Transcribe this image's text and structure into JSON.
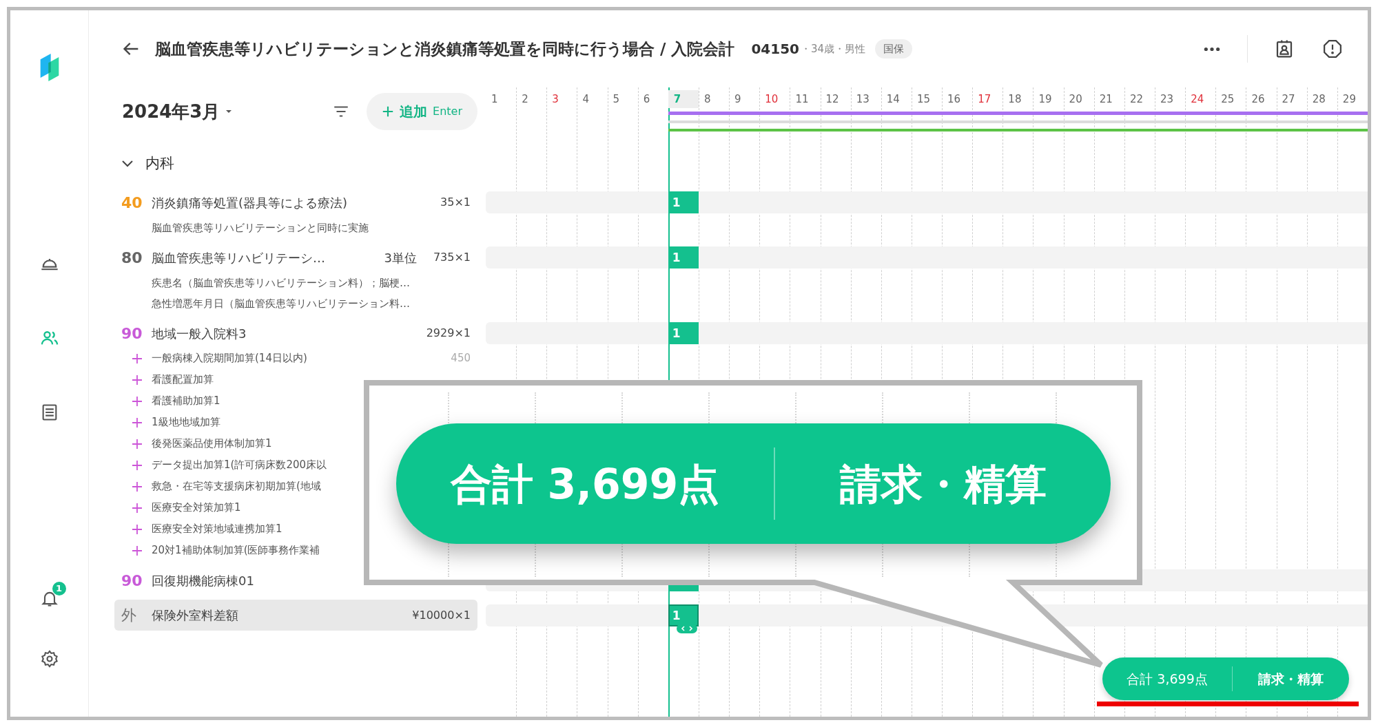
{
  "sidebar": {
    "items": [
      {
        "kind": "tray",
        "selected": false
      },
      {
        "kind": "people",
        "selected": true
      },
      {
        "kind": "list",
        "selected": false
      }
    ],
    "bottom_items": [
      {
        "kind": "bell",
        "badge": "1"
      },
      {
        "kind": "gear"
      }
    ]
  },
  "header": {
    "title": "脳血管疾患等リハビリテーションと消炎鎮痛等処置を同時に行う場合 / 入院会計",
    "patient_id": "04150",
    "details": "・34歳・男性",
    "insurance": "国保"
  },
  "toolbar": {
    "month": "2024年3月",
    "add_label": "追加",
    "add_shortcut": "Enter"
  },
  "calendar": {
    "days": [
      {
        "label": "1",
        "holiday": false,
        "selected": false
      },
      {
        "label": "2",
        "holiday": false,
        "selected": false
      },
      {
        "label": "3",
        "holiday": true,
        "selected": false
      },
      {
        "label": "4",
        "holiday": false,
        "selected": false
      },
      {
        "label": "5",
        "holiday": false,
        "selected": false
      },
      {
        "label": "6",
        "holiday": false,
        "selected": false
      },
      {
        "label": "7",
        "holiday": false,
        "selected": true
      },
      {
        "label": "8",
        "holiday": false,
        "selected": false
      },
      {
        "label": "9",
        "holiday": false,
        "selected": false
      },
      {
        "label": "10",
        "holiday": true,
        "selected": false
      },
      {
        "label": "11",
        "holiday": false,
        "selected": false
      },
      {
        "label": "12",
        "holiday": false,
        "selected": false
      },
      {
        "label": "13",
        "holiday": false,
        "selected": false
      },
      {
        "label": "14",
        "holiday": false,
        "selected": false
      },
      {
        "label": "15",
        "holiday": false,
        "selected": false
      },
      {
        "label": "16",
        "holiday": false,
        "selected": false
      },
      {
        "label": "17",
        "holiday": true,
        "selected": false
      },
      {
        "label": "18",
        "holiday": false,
        "selected": false
      },
      {
        "label": "19",
        "holiday": false,
        "selected": false
      },
      {
        "label": "20",
        "holiday": false,
        "selected": false
      },
      {
        "label": "21",
        "holiday": false,
        "selected": false
      },
      {
        "label": "22",
        "holiday": false,
        "selected": false
      },
      {
        "label": "23",
        "holiday": false,
        "selected": false
      },
      {
        "label": "24",
        "holiday": true,
        "selected": false
      },
      {
        "label": "25",
        "holiday": false,
        "selected": false
      },
      {
        "label": "26",
        "holiday": false,
        "selected": false
      },
      {
        "label": "27",
        "holiday": false,
        "selected": false
      },
      {
        "label": "28",
        "holiday": false,
        "selected": false
      },
      {
        "label": "29",
        "holiday": false,
        "selected": false
      }
    ],
    "periods": [
      {
        "color": "#a76ff0"
      },
      {
        "color": "#dcdcdc"
      },
      {
        "color": "#5cc346"
      }
    ]
  },
  "section": {
    "label": "内科",
    "expanded": true,
    "items": [
      {
        "code": "40",
        "color": "#f39c1f",
        "name": "消炎鎮痛等処置(器具等による療法)",
        "amount": "35×1",
        "notes": [
          "脳血管疾患等リハビリテーションと同時に実施"
        ],
        "count": "1",
        "selected": false
      },
      {
        "code": "80",
        "color": "#666666",
        "name": "脳血管疾患等リハビリテーシ…",
        "unit": "3単位",
        "amount": "735×1",
        "notes": [
          "疾患名（脳血管疾患等リハビリテーション料）；脳梗…",
          "急性増悪年月日（脳血管疾患等リハビリテーション料…"
        ],
        "count": "1",
        "selected": false
      },
      {
        "code": "90",
        "color": "#c85ad8",
        "name": "地域一般入院料3",
        "amount": "2929×1",
        "count": "1",
        "selected": false,
        "additions": [
          {
            "name": "一般病棟入院期間加算(14日以内)",
            "points": "450"
          },
          {
            "name": "看護配置加算"
          },
          {
            "name": "看護補助加算1"
          },
          {
            "name": "1級地地域加算"
          },
          {
            "name": "後発医薬品使用体制加算1"
          },
          {
            "name": "データ提出加算1(許可病床数200床以"
          },
          {
            "name": "救急・在宅等支援病床初期加算(地域"
          },
          {
            "name": "医療安全対策加算1"
          },
          {
            "name": "医療安全対策地域連携加算1"
          },
          {
            "name": "20対1補助体制加算(医師事務作業補"
          }
        ]
      },
      {
        "code": "90",
        "color": "#c85ad8",
        "name": "回復期機能病棟01",
        "selected": false
      },
      {
        "code": "外",
        "color": "#777777",
        "name": "保険外室料差額",
        "amount": "¥10000×1",
        "count": "1",
        "selected": true
      }
    ]
  },
  "footer": {
    "total": "合計 3,699点",
    "action": "請求・精算"
  },
  "callout": {
    "total": "合計 3,699点",
    "action": "請求・精算"
  }
}
